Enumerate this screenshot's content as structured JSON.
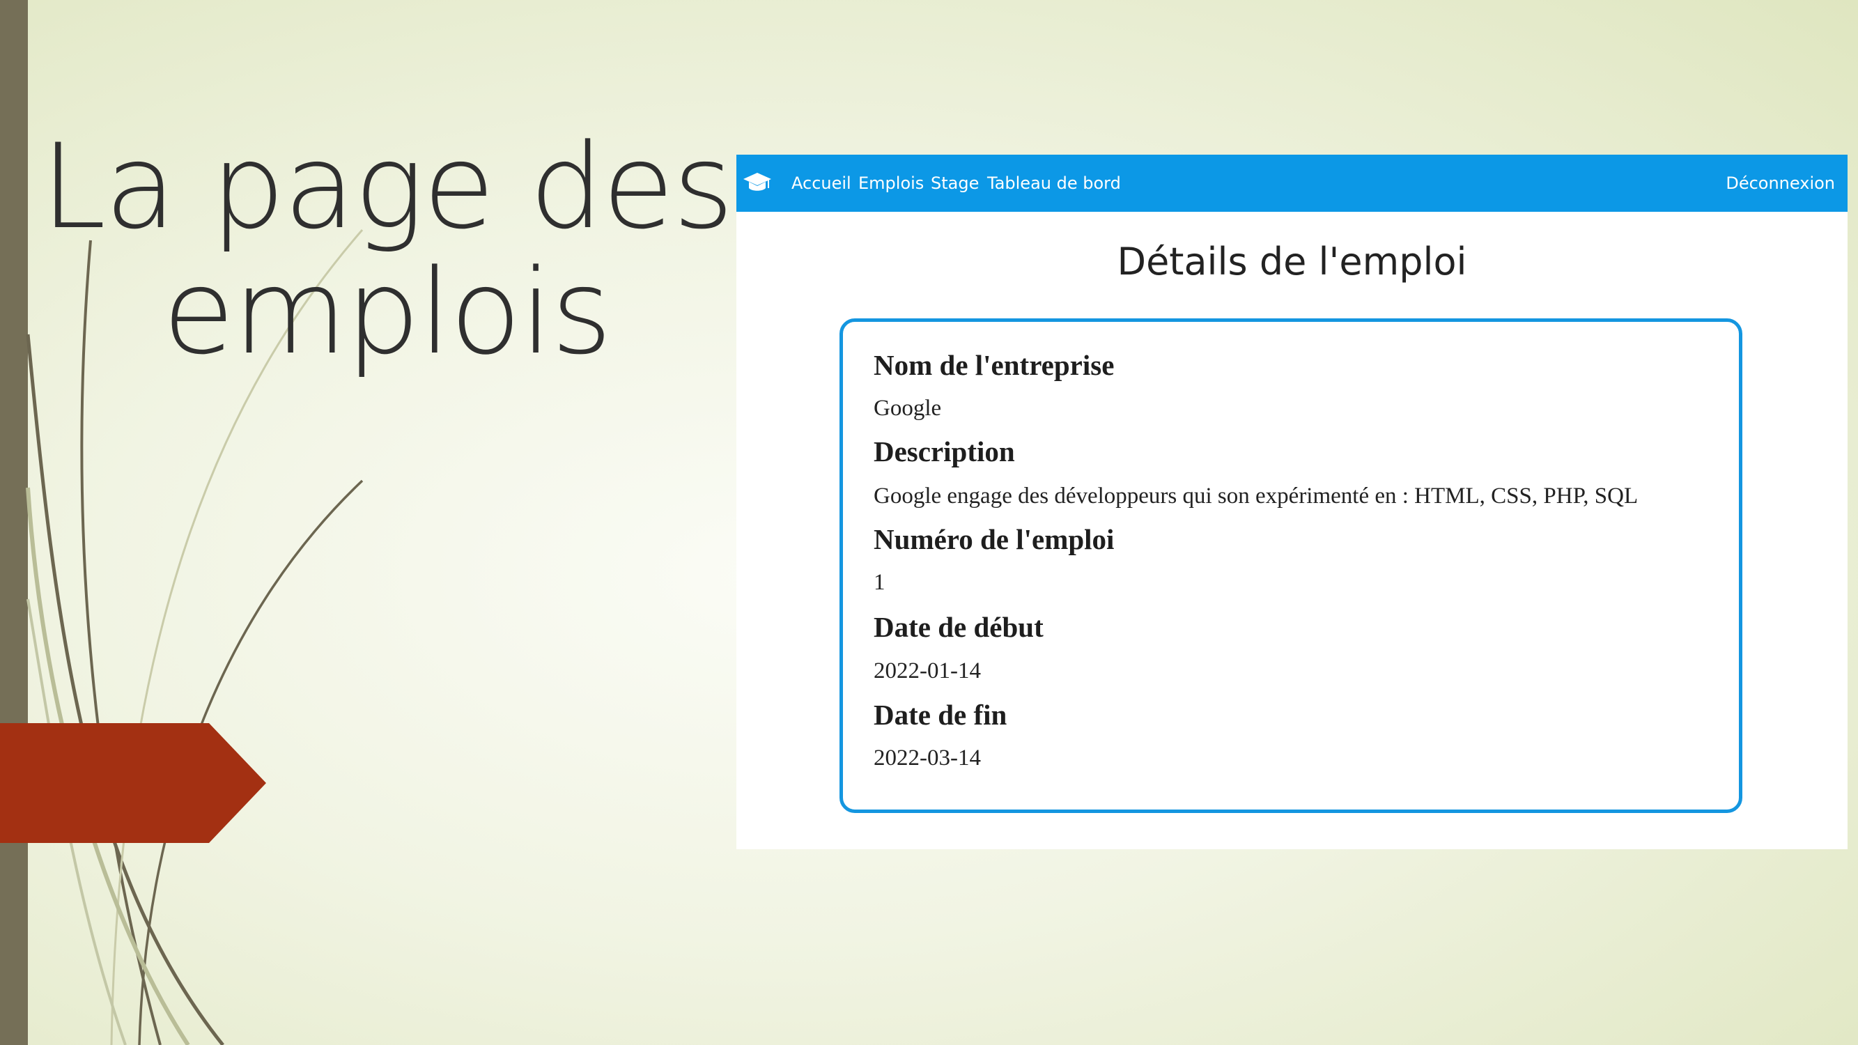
{
  "slide": {
    "title_line1": "La page des",
    "title_line2": "emplois"
  },
  "navbar": {
    "logo_icon": "graduation-cap-icon",
    "background_color": "#0c98e6",
    "links": [
      {
        "label": "Accueil"
      },
      {
        "label": "Emplois"
      },
      {
        "label": "Stage"
      },
      {
        "label": "Tableau de bord"
      }
    ],
    "logout_label": "Déconnexion"
  },
  "page": {
    "heading": "Détails de l'emploi",
    "card_border_color": "#1496e0",
    "fields": [
      {
        "label": "Nom de l'entreprise",
        "value": "Google"
      },
      {
        "label": "Description",
        "value": "Google engage des développeurs qui son expérimenté en : HTML, CSS, PHP, SQL"
      },
      {
        "label": "Numéro de l'emploi",
        "value": "1"
      },
      {
        "label": "Date de début",
        "value": "2022-01-14"
      },
      {
        "label": "Date de fin",
        "value": "2022-03-14"
      }
    ]
  },
  "colors": {
    "accent_arrow": "#a33012",
    "sidebar": "#756f57"
  }
}
